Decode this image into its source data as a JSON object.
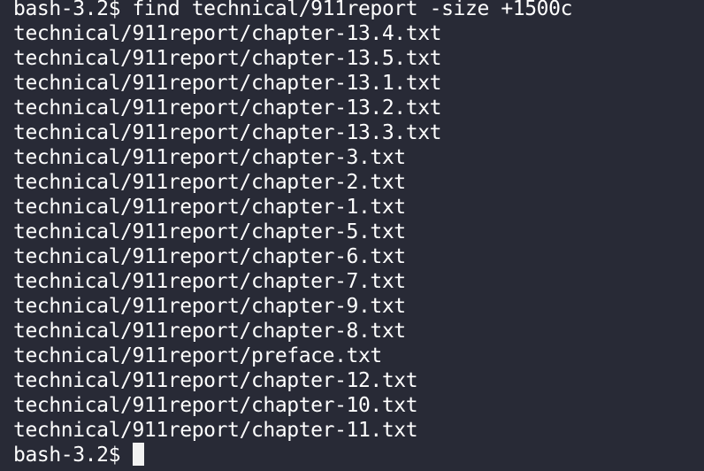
{
  "terminal": {
    "command_line": "bash-3.2$ find technical/911report -size +1500c",
    "output": [
      "technical/911report/chapter-13.4.txt",
      "technical/911report/chapter-13.5.txt",
      "technical/911report/chapter-13.1.txt",
      "technical/911report/chapter-13.2.txt",
      "technical/911report/chapter-13.3.txt",
      "technical/911report/chapter-3.txt",
      "technical/911report/chapter-2.txt",
      "technical/911report/chapter-1.txt",
      "technical/911report/chapter-5.txt",
      "technical/911report/chapter-6.txt",
      "technical/911report/chapter-7.txt",
      "technical/911report/chapter-9.txt",
      "technical/911report/chapter-8.txt",
      "technical/911report/preface.txt",
      "technical/911report/chapter-12.txt",
      "technical/911report/chapter-10.txt",
      "technical/911report/chapter-11.txt"
    ],
    "prompt": "bash-3.2$ "
  },
  "colors": {
    "background": "#282a36",
    "text": "#ffffff",
    "cursor": "#f2f2f2"
  }
}
